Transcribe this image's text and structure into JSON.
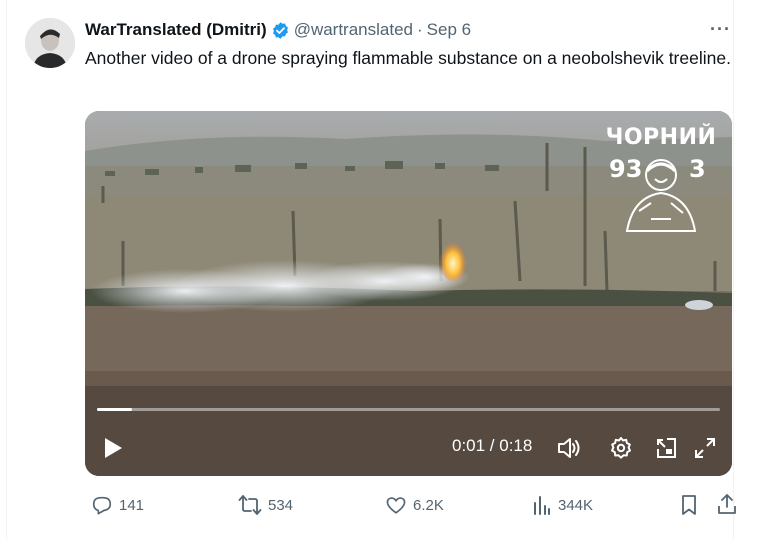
{
  "author": {
    "display_name": "WarTranslated (Dmitri)",
    "handle": "@wartranslated",
    "separator": "·",
    "date": "Sep 6",
    "verified_color": "#1d9bf0"
  },
  "more_label": "···",
  "tweet": {
    "text": "Another video of a drone spraying flammable substance on a neobolshevik treeline."
  },
  "video": {
    "watermark_name": "ЧОРНИЙ",
    "watermark_num_left": "93",
    "watermark_num_right": "3",
    "current_time": "0:01",
    "duration": "0:18",
    "time_display": "0:01 / 0:18",
    "progress_fraction": 0.056,
    "icons": [
      "play-icon",
      "volume-icon",
      "settings-icon",
      "pip-icon",
      "fullscreen-icon"
    ]
  },
  "metrics": {
    "replies": "141",
    "reposts": "534",
    "likes": "6.2K",
    "views": "344K"
  },
  "colors": {
    "text_primary": "#0f1419",
    "text_secondary": "#536471",
    "accent": "#1d9bf0"
  }
}
